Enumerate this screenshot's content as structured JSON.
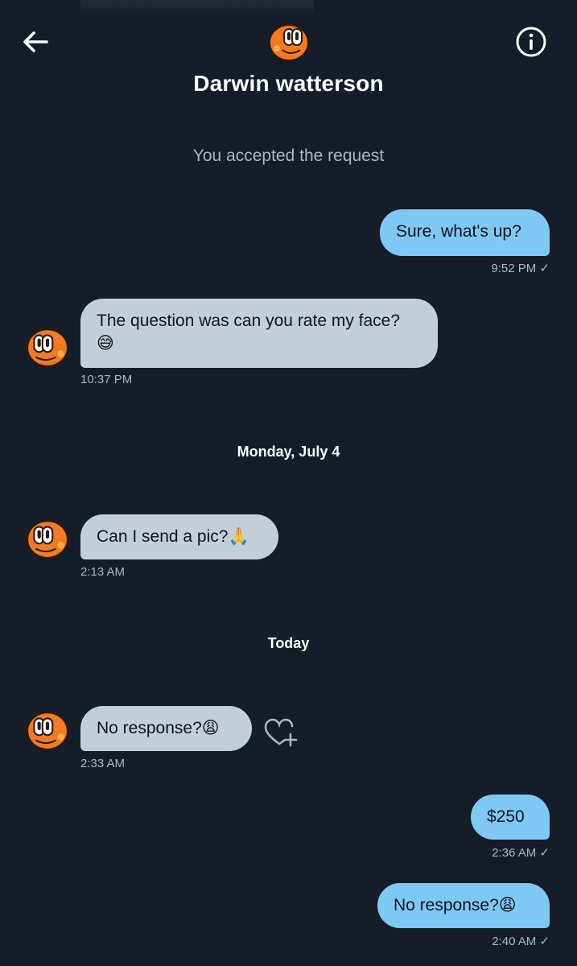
{
  "header": {
    "title": "Darwin watterson",
    "back_icon": "arrow-left-icon",
    "info_icon": "info-circle-icon",
    "avatar_icon": "darwin-avatar"
  },
  "system_note": "You accepted the request",
  "date_separators": [
    "Monday, July 4",
    "Today"
  ],
  "messages": [
    {
      "direction": "outgoing",
      "text": "Sure, what's up?",
      "time": "9:52 PM ✓"
    },
    {
      "direction": "incoming",
      "text": "The question was can you rate my face?",
      "emoji": "😅",
      "time": "10:37 PM"
    },
    {
      "direction": "incoming",
      "text": "Can I send a pic?",
      "emoji": "🙏",
      "time": "2:13 AM"
    },
    {
      "direction": "incoming",
      "text": "No response?",
      "emoji": "😩",
      "time": "2:33 AM",
      "reaction_icon": "heart-plus-icon"
    },
    {
      "direction": "outgoing",
      "text": "$250",
      "time": "2:36 AM ✓"
    },
    {
      "direction": "outgoing",
      "text": "No response?",
      "emoji": "😩",
      "time": "2:40 AM ✓"
    }
  ],
  "colors": {
    "background": "#151d28",
    "outgoing_bubble": "#7ec8f5",
    "incoming_bubble": "#c4ced8",
    "timestamp": "#aab4bf"
  }
}
